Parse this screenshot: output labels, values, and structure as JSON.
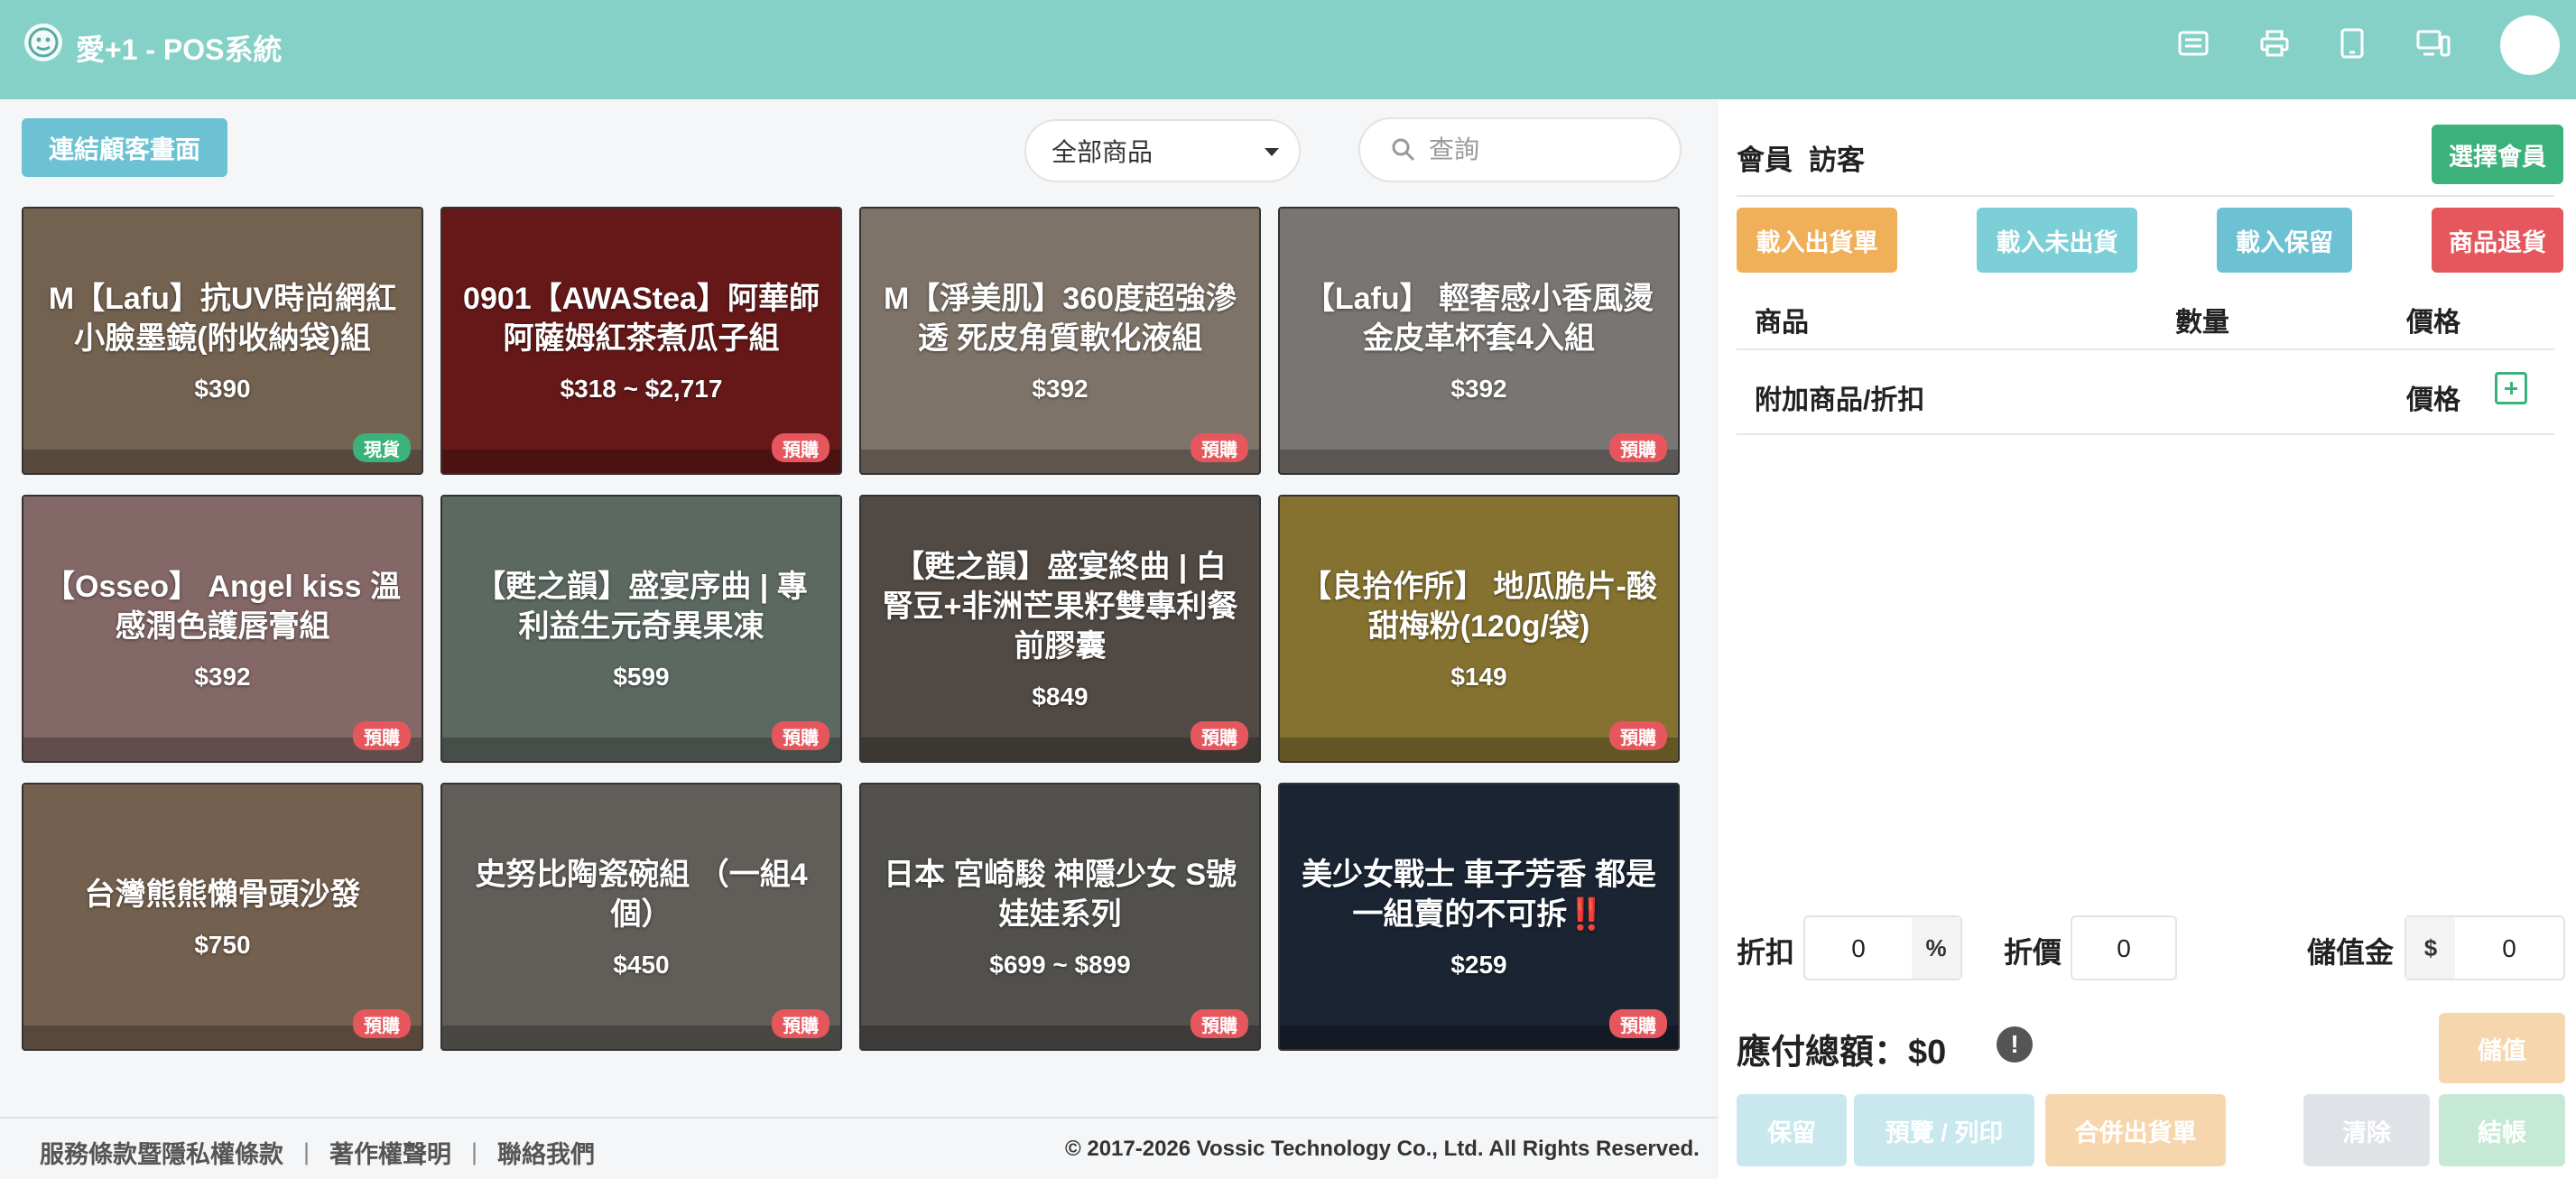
{
  "app": {
    "title": "愛+1 - POS系統"
  },
  "topbar": {
    "icons": [
      "list-icon",
      "printer-icon",
      "tablet-icon",
      "devices-icon"
    ]
  },
  "toolbar": {
    "connect_label": "連結顧客畫面",
    "category_selected": "全部商品",
    "search_placeholder": "查詢"
  },
  "products": [
    {
      "name": "M【Lafu】抗UV時尚網紅小臉墨鏡(附收納袋)組",
      "price": "$390",
      "badge": "現貨",
      "badge_type": "stock",
      "bg": "#c9a98c"
    },
    {
      "name": "0901【AWAStea】阿華師 阿薩姆紅茶煮瓜子組",
      "price": "$318 ~ $2,717",
      "badge": "預購",
      "badge_type": "pre",
      "bg": "#b02a2a"
    },
    {
      "name": "M【淨美肌】360度超強滲透 死皮角質軟化液組",
      "price": "$392",
      "badge": "預購",
      "badge_type": "pre",
      "bg": "#d8c6b4"
    },
    {
      "name": "【Lafu】 輕奢感小香風燙金皮革杯套4入組",
      "price": "$392",
      "badge": "預購",
      "badge_type": "pre",
      "bg": "#cfcac4"
    },
    {
      "name": "【Osseo】 Angel kiss 溫感潤色護唇膏組",
      "price": "$392",
      "badge": "預購",
      "badge_type": "pre",
      "bg": "#e3b2b2"
    },
    {
      "name": "【甦之韻】盛宴序曲 | 專利益生元奇異果凍",
      "price": "$599",
      "badge": "預購",
      "badge_type": "pre",
      "bg": "#9fb5a8"
    },
    {
      "name": "【甦之韻】盛宴終曲 | 白腎豆+非洲芒果籽雙專利餐前膠囊",
      "price": "$849",
      "badge": "預購",
      "badge_type": "pre",
      "bg": "#8a7f76"
    },
    {
      "name": "【良拾作所】 地瓜脆片-酸甜梅粉(120g/袋)",
      "price": "$149",
      "badge": "預購",
      "badge_type": "pre",
      "bg": "#e6c453"
    },
    {
      "name": "台灣熊熊懶骨頭沙發",
      "price": "$750",
      "badge": "預購",
      "badge_type": "pre",
      "bg": "#c8a688"
    },
    {
      "name": "史努比陶瓷碗組 （一組4個）",
      "price": "$450",
      "badge": "預購",
      "badge_type": "pre",
      "bg": "#a8a39c"
    },
    {
      "name": "日本 宮崎駿 神隱少女 S號娃娃系列",
      "price": "$699 ~ $899",
      "badge": "預購",
      "badge_type": "pre",
      "bg": "#8e8a86"
    },
    {
      "name": "美少女戰士 車子芳香 都是一組賣的不可拆‼️",
      "price": "$259",
      "badge": "預購",
      "badge_type": "pre",
      "bg": "#2e3e58"
    }
  ],
  "footer": {
    "links": [
      "服務條款暨隱私權條款",
      "著作權聲明",
      "聯絡我們"
    ],
    "copyright": "© 2017-2026 Vossic Technology Co., Ltd. All Rights Reserved."
  },
  "cart": {
    "member_label": "會員",
    "member_name": "訪客",
    "select_member": "選擇會員",
    "actions": [
      "載入出貨單",
      "載入未出貨",
      "載入保留",
      "商品退貨"
    ],
    "headers": {
      "item": "商品",
      "qty": "數量",
      "price": "價格"
    },
    "addon_label": "附加商品/折扣",
    "addon_price": "價格",
    "discount_label": "折扣",
    "discount_value": "0",
    "discount_unit": "%",
    "price_off_label": "折價",
    "price_off_value": "0",
    "stored_label": "儲值金",
    "stored_currency": "$",
    "stored_value": "0",
    "total_label": "應付總額：$0",
    "store_button": "儲值",
    "bottom_buttons": [
      "保留",
      "預覽 / 列印",
      "合併出貨單",
      "清除",
      "結帳"
    ]
  },
  "colors": {
    "topbar": "#86d1c7",
    "connect": "#6cc2d3",
    "green": "#3bb27a",
    "orange": "#f0b05a",
    "teal": "#7ccfd6",
    "red": "#e6565d"
  }
}
